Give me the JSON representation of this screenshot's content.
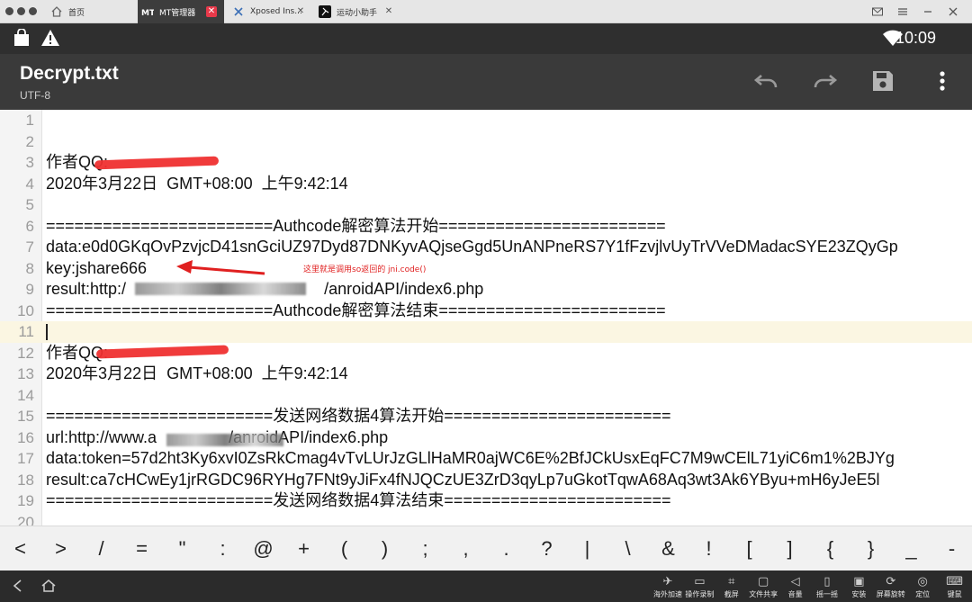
{
  "tabs": [
    {
      "label": "首页"
    },
    {
      "label": "MT管理器"
    },
    {
      "label": "Xposed Ins..."
    },
    {
      "label": "运动小助手"
    }
  ],
  "status": {
    "time": "10:09"
  },
  "appbar": {
    "title": "Decrypt.txt",
    "encoding": "UTF-8"
  },
  "editor": {
    "lines": [
      {
        "n": "1",
        "text": ""
      },
      {
        "n": "2",
        "text": ""
      },
      {
        "n": "3",
        "text": "作者QQ:"
      },
      {
        "n": "4",
        "text": "2020年3月22日  GMT+08:00  上午9:42:14"
      },
      {
        "n": "5",
        "text": ""
      },
      {
        "n": "6",
        "text": "========================Authcode解密算法开始========================"
      },
      {
        "n": "7",
        "text": "data:e0d0GKqOvPzvjcD41snGciUZ97Dyd87DNKyvAQjseGgd5UnANPneRS7Y1fFzvjlvUyTrVVeDMadacSYE23ZQyGp"
      },
      {
        "n": "8",
        "text": "key:jshare666"
      },
      {
        "n": "9",
        "text": "result:http:/                                            /anroidAPI/index6.php"
      },
      {
        "n": "10",
        "text": "========================Authcode解密算法结束========================"
      },
      {
        "n": "11",
        "text": ""
      },
      {
        "n": "12",
        "text": "作者QQ:"
      },
      {
        "n": "13",
        "text": "2020年3月22日  GMT+08:00  上午9:42:14"
      },
      {
        "n": "14",
        "text": ""
      },
      {
        "n": "15",
        "text": "========================发送网络数据4算法开始========================"
      },
      {
        "n": "16",
        "text": "url:http://www.a                /anroidAPI/index6.php"
      },
      {
        "n": "17",
        "text": "data:token=57d2ht3Ky6xvI0ZsRkCmag4vTvLUrJzGLlHaMR0ajWC6E%2BfJCkUsxEqFC7M9wCElL71yiC6m1%2BJYg"
      },
      {
        "n": "18",
        "text": "result:ca7cHCwEy1jrRGDC96RYHg7FNt9yJiFx4fNJQCzUE3ZrD3qyLp7uGkotTqwA68Aq3wt3Ak6YByu+mH6yJeE5l"
      },
      {
        "n": "19",
        "text": "========================发送网络数据4算法结束========================"
      },
      {
        "n": "20",
        "text": ""
      }
    ],
    "annotation": "这里就是调用so返回的 jni.code()"
  },
  "symbols": [
    "<",
    ">",
    "/",
    "=",
    "\"",
    ":",
    "@",
    "+",
    "(",
    ")",
    ";",
    ",",
    ".",
    "?",
    "|",
    "\\",
    "&",
    "!",
    "[",
    "]",
    "{",
    "}",
    "_",
    "-"
  ],
  "toolbar": [
    {
      "label": "海外加速"
    },
    {
      "label": "操作录制"
    },
    {
      "label": "截屏"
    },
    {
      "label": "文件共享"
    },
    {
      "label": "音量"
    },
    {
      "label": "摇一摇"
    },
    {
      "label": "安装"
    },
    {
      "label": "屏幕旋转"
    },
    {
      "label": "定位"
    },
    {
      "label": "键鼠"
    }
  ]
}
